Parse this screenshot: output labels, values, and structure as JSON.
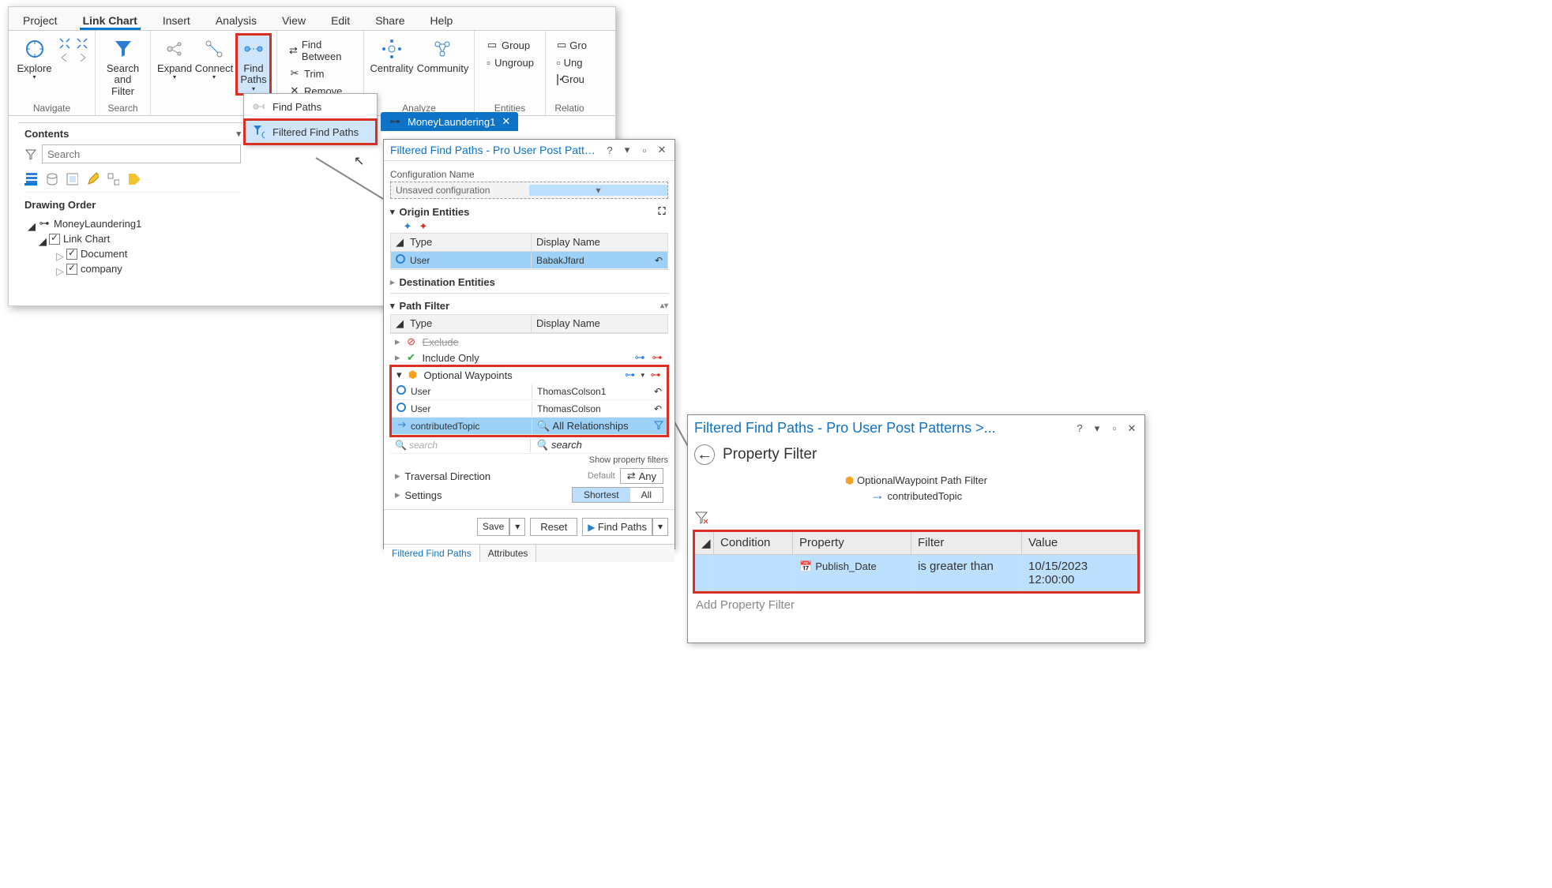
{
  "ribbon": {
    "tabs": [
      "Project",
      "Link Chart",
      "Insert",
      "Analysis",
      "View",
      "Edit",
      "Share",
      "Help"
    ],
    "activeTab": "Link Chart",
    "groups": {
      "navigate": "Navigate",
      "search": "Search",
      "searchFilter": "Search\nand Filter",
      "explore": "Explore",
      "expand": "Expand",
      "connect": "Connect",
      "findPaths": "Find\nPaths",
      "findBetween": "Find Between",
      "trim": "Trim",
      "remove": "Remove",
      "analyze": "Analyze",
      "centrality": "Centrality",
      "community": "Community",
      "entities": "Entities",
      "group": "Group",
      "ungroup": "Ungroup",
      "relatio": "Relatio",
      "grouCheckbox": "Grou",
      "gro": "Gro",
      "ung": "Ung"
    }
  },
  "dropdown": {
    "findPaths": "Find Paths",
    "filteredFindPaths": "Filtered Find Paths"
  },
  "contents": {
    "title": "Contents",
    "searchPlaceholder": "Search",
    "drawingOrder": "Drawing Order",
    "layer": "MoneyLaundering1",
    "linkChart": "Link Chart",
    "document": "Document",
    "company": "company"
  },
  "chartTab": "MoneyLaundering1",
  "ffp": {
    "title": "Filtered Find Paths - Pro User Post Patterns >...",
    "configName": "Configuration Name",
    "configValue": "Unsaved configuration",
    "originEntities": "Origin Entities",
    "destEntities": "Destination Entities",
    "pathFilter": "Path Filter",
    "type": "Type",
    "displayName": "Display Name",
    "exclude": "Exclude",
    "includeOnly": "Include Only",
    "optionalWaypoints": "Optional Waypoints",
    "origin": {
      "type": "User",
      "dn": "BabakJfard"
    },
    "wp": [
      {
        "type": "User",
        "dn": "ThomasColson1"
      },
      {
        "type": "User",
        "dn": "ThomasColson"
      },
      {
        "type": "contributedTopic",
        "dn": "All Relationships"
      }
    ],
    "search": "search",
    "travDir": "Traversal Direction",
    "default": "Default",
    "any": "Any",
    "settings": "Settings",
    "shortest": "Shortest",
    "all": "All",
    "save": "Save",
    "reset": "Reset",
    "findPathsBtn": "Find Paths",
    "tabFFP": "Filtered Find Paths",
    "tabAttr": "Attributes",
    "showPropFilters": "Show property filters"
  },
  "pf": {
    "title": "Filtered Find Paths - Pro User Post Patterns >...",
    "propFilter": "Property Filter",
    "optWp": "OptionalWaypoint Path Filter",
    "contrib": "contributedTopic",
    "cols": {
      "cond": "Condition",
      "prop": "Property",
      "filt": "Filter",
      "val": "Value"
    },
    "row": {
      "cond": "",
      "prop": "Publish_Date",
      "filt": "is greater than",
      "val": "10/15/2023 12:00:00"
    },
    "add": "Add Property Filter"
  }
}
